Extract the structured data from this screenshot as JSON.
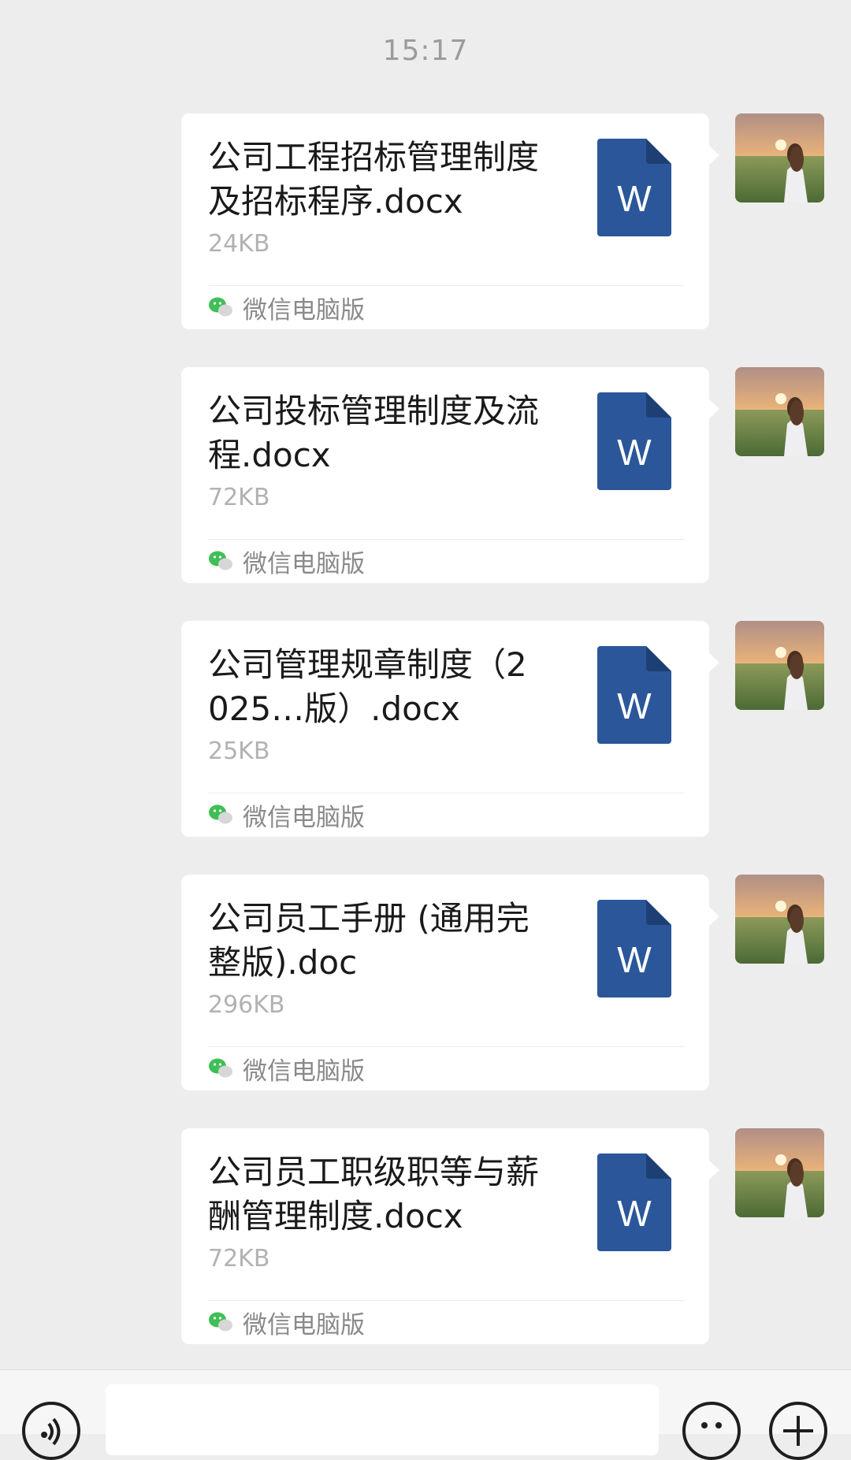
{
  "chat": {
    "timestamp": "15:17",
    "messages": [
      {
        "file_name": "公司工程招标管理制度及招标程序.docx",
        "file_size": "24KB",
        "file_type_icon": "word-doc-icon",
        "source": "微信电脑版"
      },
      {
        "file_name": "公司投标管理制度及流程.docx",
        "file_size": "72KB",
        "file_type_icon": "word-doc-icon",
        "source": "微信电脑版"
      },
      {
        "file_name": "公司管理规章制度（2025…版）.docx",
        "file_size": "25KB",
        "file_type_icon": "word-doc-icon",
        "source": "微信电脑版"
      },
      {
        "file_name": "公司员工手册 (通用完整版).doc",
        "file_size": "296KB",
        "file_type_icon": "word-doc-icon",
        "source": "微信电脑版"
      },
      {
        "file_name": "公司员工职级职等与薪酬管理制度.docx",
        "file_size": "72KB",
        "file_type_icon": "word-doc-icon",
        "source": "微信电脑版"
      }
    ]
  },
  "icons": {
    "word_letter": "W",
    "voice": "voice-icon",
    "emoji": "emoji-icon",
    "plus": "plus-icon"
  },
  "colors": {
    "background": "#ededed",
    "bubble": "#ffffff",
    "word_blue": "#2b579a",
    "wechat_green": "#3fbf56"
  }
}
